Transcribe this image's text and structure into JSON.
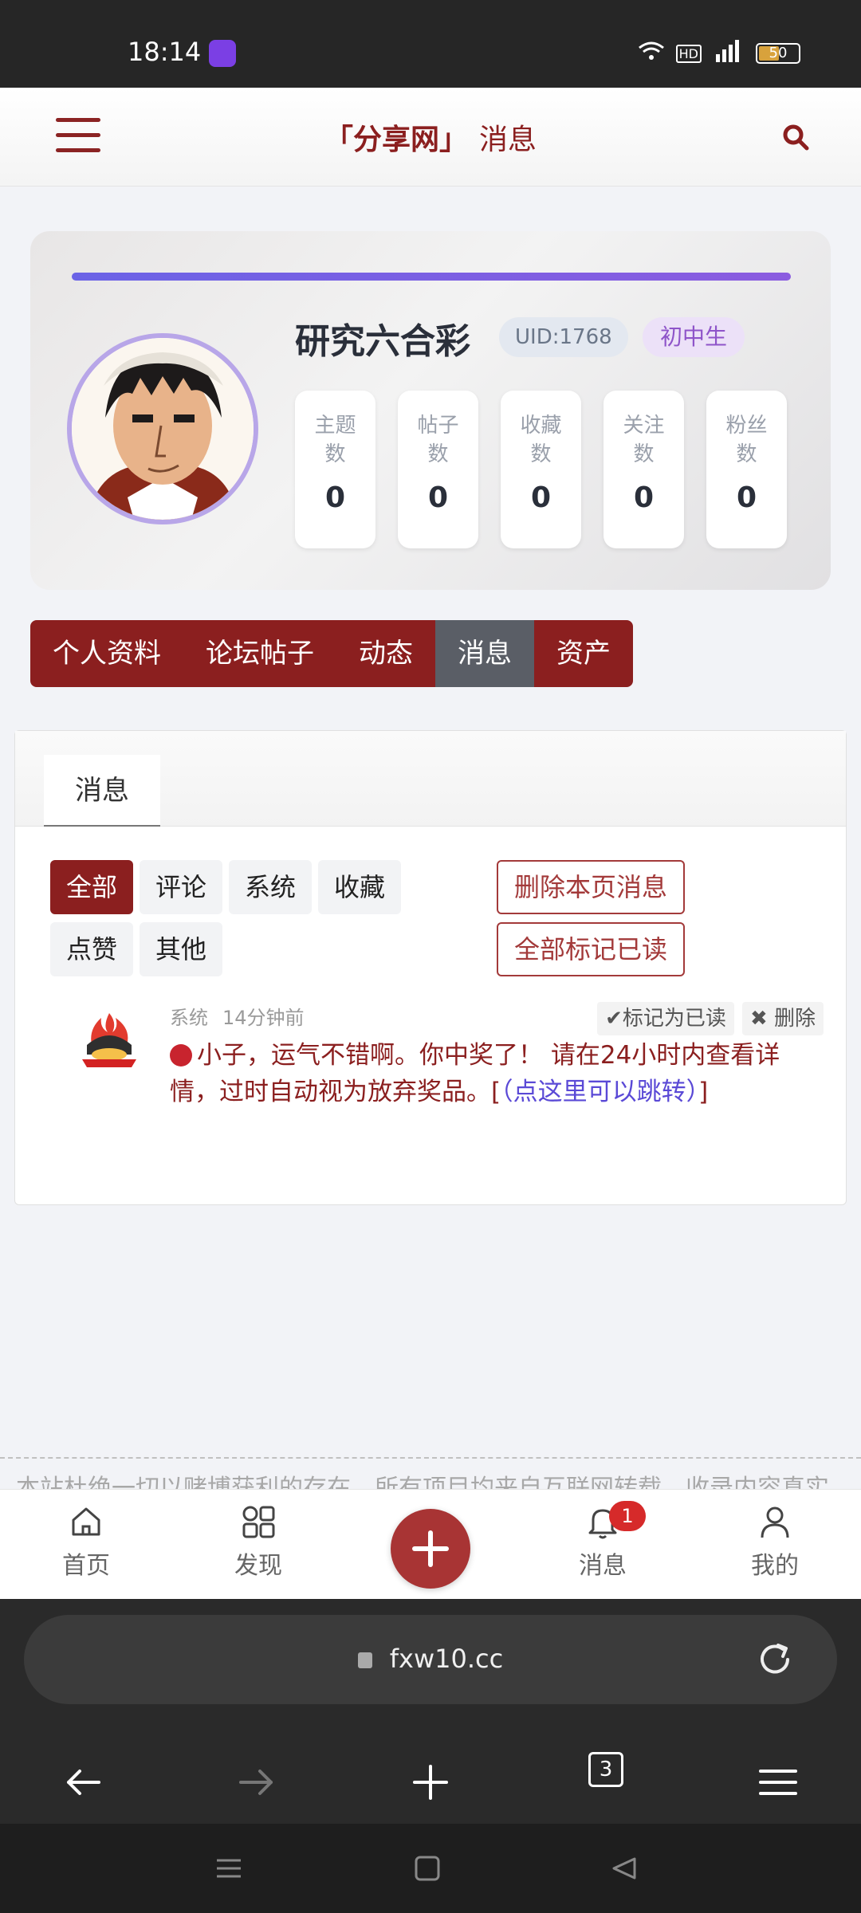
{
  "status_bar": {
    "time": "18:14",
    "battery": "50"
  },
  "header": {
    "brand": "「分享网」",
    "title": "消息"
  },
  "profile": {
    "username": "研究六合彩",
    "uid": "UID:1768",
    "grade": "初中生",
    "stats": [
      {
        "label": "主题数",
        "value": "0"
      },
      {
        "label": "帖子数",
        "value": "0"
      },
      {
        "label": "收藏数",
        "value": "0"
      },
      {
        "label": "关注数",
        "value": "0"
      },
      {
        "label": "粉丝数",
        "value": "0"
      }
    ]
  },
  "nav_tabs": [
    {
      "label": "个人资料"
    },
    {
      "label": "论坛帖子"
    },
    {
      "label": "动态"
    },
    {
      "label": "消息",
      "active": true
    },
    {
      "label": "资产"
    }
  ],
  "messages_panel": {
    "tab_label": "消息",
    "filters": [
      "全部",
      "评论",
      "系统",
      "收藏",
      "点赞",
      "其他"
    ],
    "delete_page_label": "删除本页消息",
    "mark_all_read_label": "全部标记已读",
    "items": [
      {
        "type": "系统",
        "time": "14分钟前",
        "mark_read_label": "✔标记为已读",
        "delete_label": "✖ 删除",
        "text": "小子，运气不错啊。你中奖了！ 请在24小时内查看详情，过时自动视为放弃奖品。[",
        "link_text": "（点这里可以跳转）",
        "text_end": "]"
      }
    ]
  },
  "footer_note": "本站杜绝一切以赌博获利的存在，所有项目均来自互联网转载，收录内容真实",
  "bottom_nav": {
    "home": "首页",
    "discover": "发现",
    "messages": "消息",
    "messages_badge": "1",
    "me": "我的"
  },
  "browser": {
    "url": "fxw10.cc",
    "tab_count": "3"
  },
  "colors": {
    "brand": "#8b1f1f",
    "accent_bar": "#6b63e6",
    "link": "#5a49d6",
    "badge": "#d62a2a"
  }
}
